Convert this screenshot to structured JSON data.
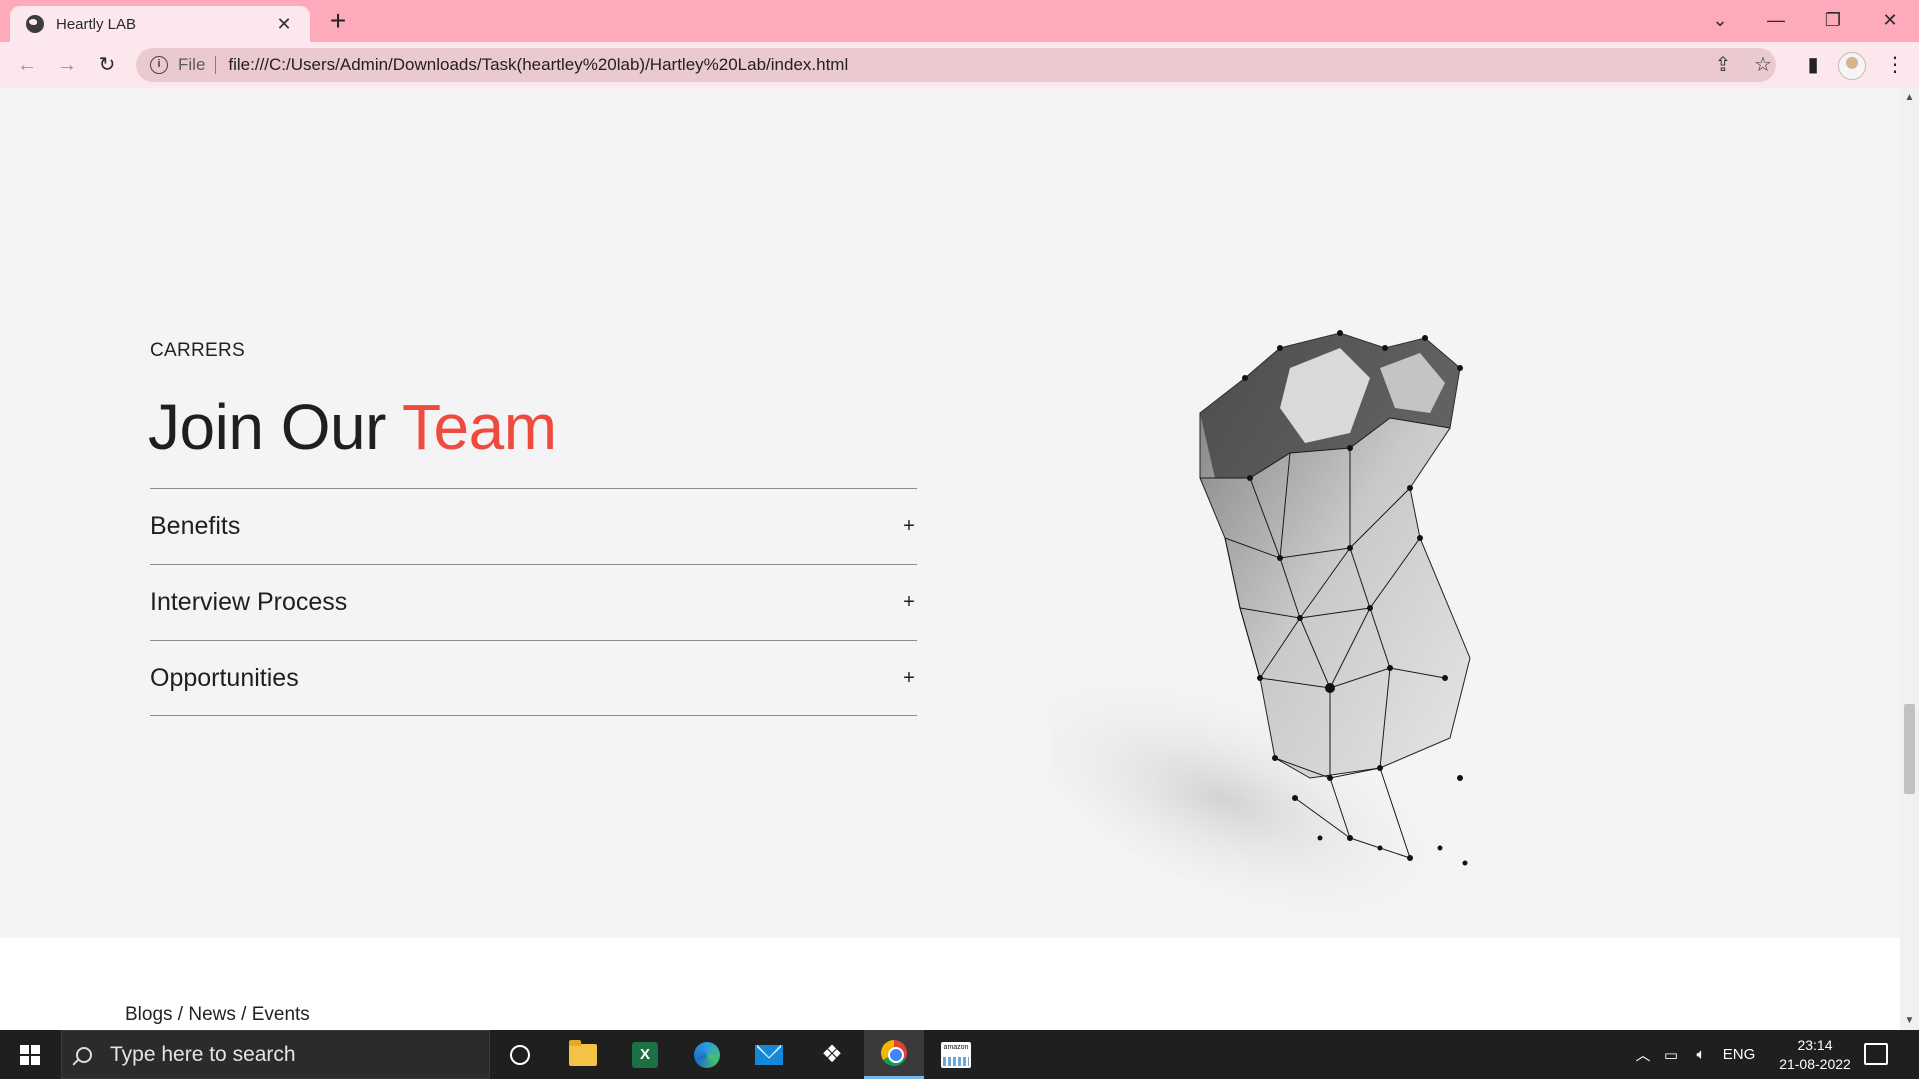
{
  "browser": {
    "tab_title": "Heartly LAB",
    "tab_close": "✕",
    "new_tab": "+",
    "scheme_label": "File",
    "url": "file:///C:/Users/Admin/Downloads/Task(heartley%20lab)/Hartley%20Lab/index.html",
    "window_controls": {
      "tab_search": "⌄",
      "minimize": "—",
      "restore": "❐",
      "close": "✕"
    }
  },
  "careers": {
    "label": "CARRERS",
    "heading_main": "Join Our ",
    "heading_accent": "Team",
    "accordion": [
      {
        "label": "Benefits",
        "toggle": "+"
      },
      {
        "label": "Interview Process",
        "toggle": "+"
      },
      {
        "label": "Opportunities",
        "toggle": "+"
      }
    ]
  },
  "next_section": {
    "label": "Blogs / News / Events"
  },
  "taskbar": {
    "search_placeholder": "Type here to search",
    "apps": [
      "cortana",
      "file-explorer",
      "excel",
      "edge",
      "mail",
      "dropbox",
      "chrome",
      "amazon"
    ],
    "language": "ENG",
    "time": "23:14",
    "date": "21-08-2022"
  },
  "colors": {
    "tabstrip": "#fdaaba",
    "toolbar": "#fbe7ec",
    "accent": "#ee4a3d",
    "page_bg": "#f4f4f6"
  }
}
